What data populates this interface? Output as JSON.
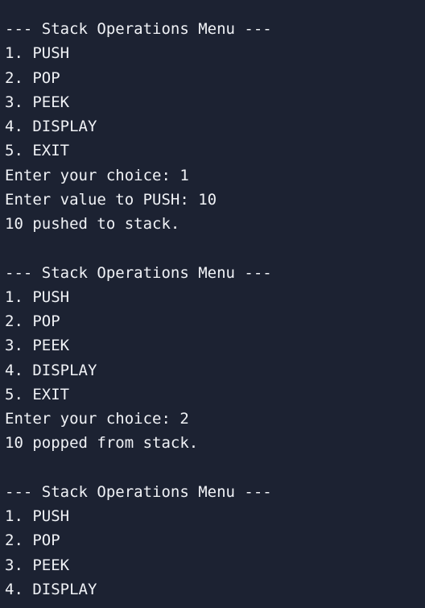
{
  "terminal": {
    "lines": [
      "--- Stack Operations Menu ---",
      "1. PUSH",
      "2. POP",
      "3. PEEK",
      "4. DISPLAY",
      "5. EXIT",
      "Enter your choice: 1",
      "Enter value to PUSH: 10",
      "10 pushed to stack.",
      "",
      "--- Stack Operations Menu ---",
      "1. PUSH",
      "2. POP",
      "3. PEEK",
      "4. DISPLAY",
      "5. EXIT",
      "Enter your choice: 2",
      "10 popped from stack.",
      "",
      "--- Stack Operations Menu ---",
      "1. PUSH",
      "2. POP",
      "3. PEEK",
      "4. DISPLAY"
    ]
  }
}
